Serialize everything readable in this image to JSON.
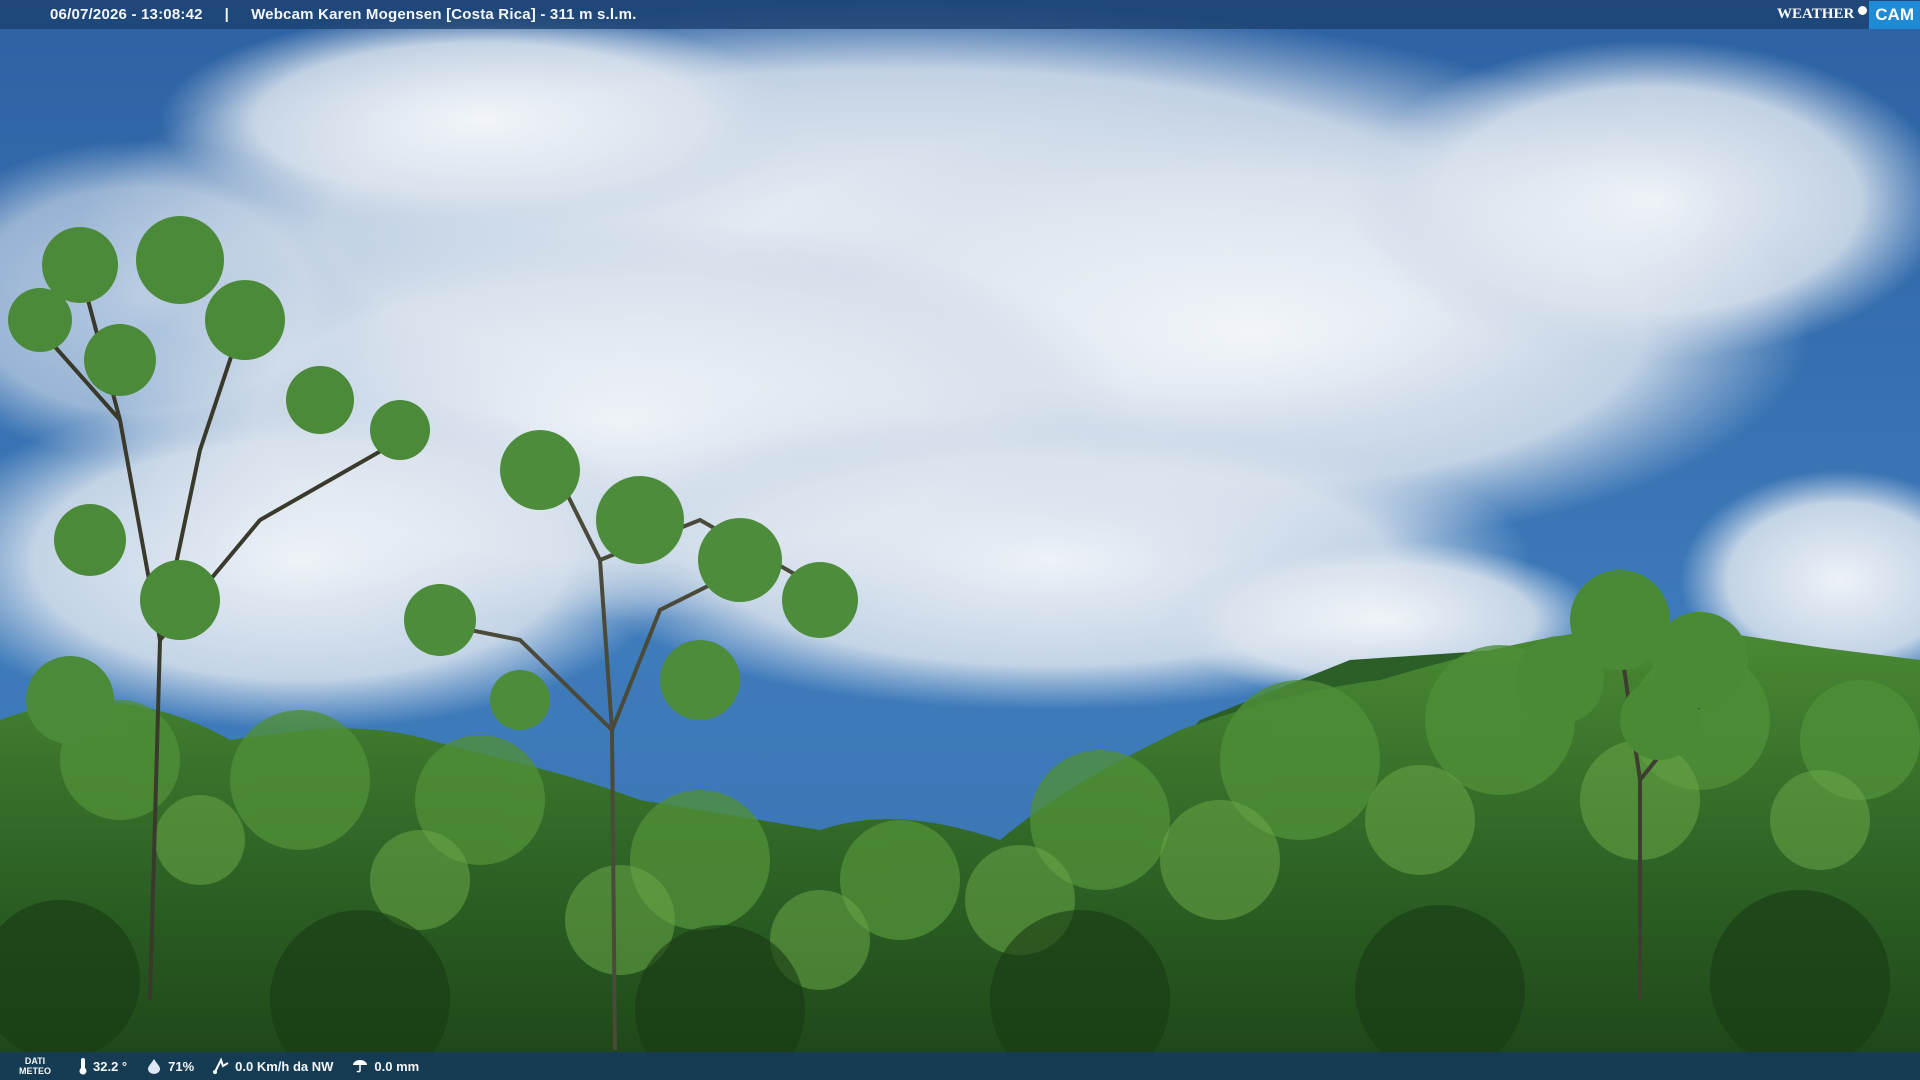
{
  "header": {
    "datetime": "06/07/2026 - 13:08:42",
    "separator": "|",
    "camera_title": "Webcam Karen Mogensen [Costa Rica] - 311 m s.l.m."
  },
  "logo": {
    "text_weather": "WEATHER",
    "text_cam": "CAM"
  },
  "footer": {
    "label_line1": "DATI",
    "label_line2": "METEO",
    "temperature": "32.2 °",
    "humidity": "71%",
    "wind": "0.0 Km/h da NW",
    "rain": "0.0 mm"
  },
  "colors": {
    "sky_top": "#2f66a8",
    "sky_bottom": "#3c78b8",
    "cloud": "#eef2f6",
    "forest_dark": "#1f4a1c",
    "forest_mid": "#3f7a2e",
    "forest_light": "#6ea44a"
  }
}
